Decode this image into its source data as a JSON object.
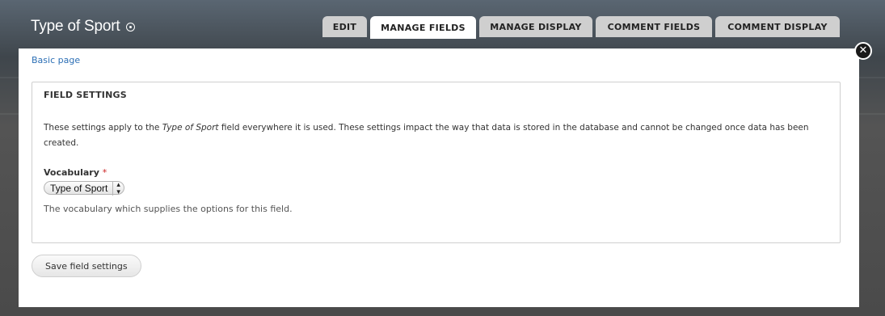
{
  "header": {
    "title": "Type of Sport"
  },
  "tabs": [
    {
      "label": "EDIT",
      "active": false
    },
    {
      "label": "MANAGE FIELDS",
      "active": true
    },
    {
      "label": "MANAGE DISPLAY",
      "active": false
    },
    {
      "label": "COMMENT FIELDS",
      "active": false
    },
    {
      "label": "COMMENT DISPLAY",
      "active": false
    }
  ],
  "breadcrumb": "Basic page",
  "close_icon": "close-icon",
  "field_settings": {
    "legend": "FIELD SETTINGS",
    "description_before": "These settings apply to the ",
    "description_field": "Type of Sport",
    "description_after": " field everywhere it is used. These settings impact the way that data is stored in the database and cannot be changed once data has been created.",
    "vocabulary_label": "Vocabulary",
    "required_marker": "*",
    "vocabulary_value": "Type of Sport",
    "vocabulary_help": "The vocabulary which supplies the options for this field."
  },
  "actions": {
    "save_label": "Save field settings"
  },
  "colors": {
    "link": "#2c6fb5",
    "required": "#cc2222",
    "overlay": "#4d4d4d"
  }
}
